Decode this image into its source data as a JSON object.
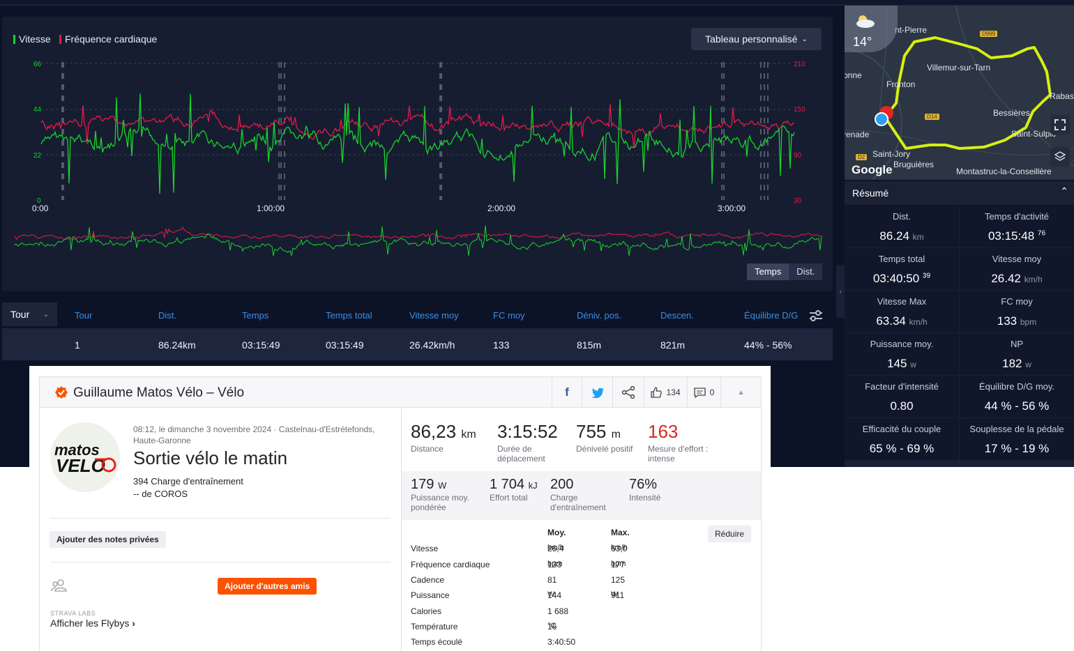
{
  "chart": {
    "legend_speed": "Vitesse",
    "legend_hr": "Fréquence cardiaque",
    "speed_color": "#19d42c",
    "hr_color": "#e6194b",
    "custom_table_label": "Tableau personnalisé",
    "y_left_ticks": [
      "66",
      "44",
      "22",
      "0"
    ],
    "y_right_ticks": [
      "210",
      "150",
      "90",
      "30"
    ],
    "x_ticks": [
      "0:00",
      "1:00:00",
      "2:00:00",
      "3:00:00"
    ],
    "toggle_time": "Temps",
    "toggle_dist": "Dist."
  },
  "laps": {
    "select_label": "Tour",
    "headers": [
      "Tour",
      "Dist.",
      "Temps",
      "Temps total",
      "Vitesse moy",
      "FC moy",
      "Déniv. pos.",
      "Descen.",
      "Équilibre D/G"
    ],
    "row": [
      "1",
      "86.24km",
      "03:15:49",
      "03:15:49",
      "26.42km/h",
      "133",
      "815m",
      "821m",
      "44% - 56%"
    ]
  },
  "map": {
    "weather_temp": "14°",
    "labels": [
      "nt-Pierre",
      "Villemur-sur-Tarn",
      "Fronton",
      "Rabas",
      "Bessières",
      "renade",
      "Saint-Sulpic",
      "Saint-Jory",
      "Bruguières",
      "Montastruc-la-Conseillère",
      "onne"
    ],
    "roads": [
      "D999",
      "D14",
      "D2"
    ],
    "google": "Google"
  },
  "resume": {
    "title": "Résumé",
    "items": [
      {
        "label": "Dist.",
        "value": "86.24",
        "unit": "km",
        "sup": ""
      },
      {
        "label": "Temps d'activité",
        "value": "03:15:48",
        "unit": "",
        "sup": "76"
      },
      {
        "label": "Temps total",
        "value": "03:40:50",
        "unit": "",
        "sup": "39"
      },
      {
        "label": "Vitesse moy",
        "value": "26.42",
        "unit": "km/h",
        "sup": ""
      },
      {
        "label": "Vitesse Max",
        "value": "63.34",
        "unit": "km/h",
        "sup": ""
      },
      {
        "label": "FC moy",
        "value": "133",
        "unit": "bpm",
        "sup": ""
      },
      {
        "label": "Puissance moy.",
        "value": "145",
        "unit": "w",
        "sup": ""
      },
      {
        "label": "NP",
        "value": "182",
        "unit": "w",
        "sup": ""
      },
      {
        "label": "Facteur d'intensité",
        "value": "0.80",
        "unit": "",
        "sup": ""
      },
      {
        "label": "Équilibre D/G moy.",
        "value": "44 % - 56 %",
        "unit": "",
        "sup": ""
      },
      {
        "label": "Efficacité du couple",
        "value": "65 % - 69 %",
        "unit": "",
        "sup": ""
      },
      {
        "label": "Souplesse de la pédale",
        "value": "17 % - 19 %",
        "unit": "",
        "sup": ""
      }
    ]
  },
  "strava": {
    "title": "Guillaume Matos Vélo – Vélo",
    "kudos": "134",
    "comments": "0",
    "meta": "08:12, le dimanche 3 novembre 2024 · Castelnau-d'Estrétefonds, Haute-Garonne",
    "activity": "Sortie vélo le matin",
    "load_line1": "394 Charge d'entraînement",
    "load_line2": "-- de COROS",
    "notes_btn": "Ajouter des notes privées",
    "add_friends_btn": "Ajouter d'autres amis",
    "labs": "STRAVA LABS",
    "flybys": "Afficher les Flybys",
    "stats": [
      {
        "value": "86,23",
        "unit": "km",
        "label": "Distance"
      },
      {
        "value": "3:15:52",
        "unit": "",
        "label": "Durée de déplacement"
      },
      {
        "value": "755",
        "unit": "m",
        "label": "Dénivelé positif"
      },
      {
        "value": "163",
        "unit": "",
        "label": "Mesure d'effort : intense"
      }
    ],
    "stats2": [
      {
        "value": "179",
        "unit": "W",
        "label": "Puissance moy. pondérée"
      },
      {
        "value": "1 704",
        "unit": "kJ",
        "label": "Effort total"
      },
      {
        "value": "200",
        "unit": "",
        "label": "Charge d'entraînement"
      },
      {
        "value": "76%",
        "unit": "",
        "label": "Intensité"
      }
    ],
    "reduce_btn": "Réduire",
    "col_avg": "Moy.",
    "col_max": "Max.",
    "rows": [
      {
        "name": "Vitesse",
        "avg": "26,4",
        "avg_unit": "km/h",
        "max": "63,0",
        "max_unit": "km/h"
      },
      {
        "name": "Fréquence cardiaque",
        "avg": "133",
        "avg_unit": "bpm",
        "max": "177",
        "max_unit": "bpm"
      },
      {
        "name": "Cadence",
        "avg": "81",
        "avg_unit": "",
        "max": "125",
        "max_unit": ""
      },
      {
        "name": "Puissance",
        "avg": "144",
        "avg_unit": "W",
        "max": "911",
        "max_unit": "W"
      },
      {
        "name": "Calories",
        "avg": "1 688",
        "avg_unit": "",
        "max": "",
        "max_unit": ""
      },
      {
        "name": "Température",
        "avg": "16",
        "avg_unit": "°C",
        "max": "",
        "max_unit": ""
      },
      {
        "name": "Temps écoulé",
        "avg": "3:40:50",
        "avg_unit": "",
        "max": "",
        "max_unit": ""
      }
    ]
  }
}
